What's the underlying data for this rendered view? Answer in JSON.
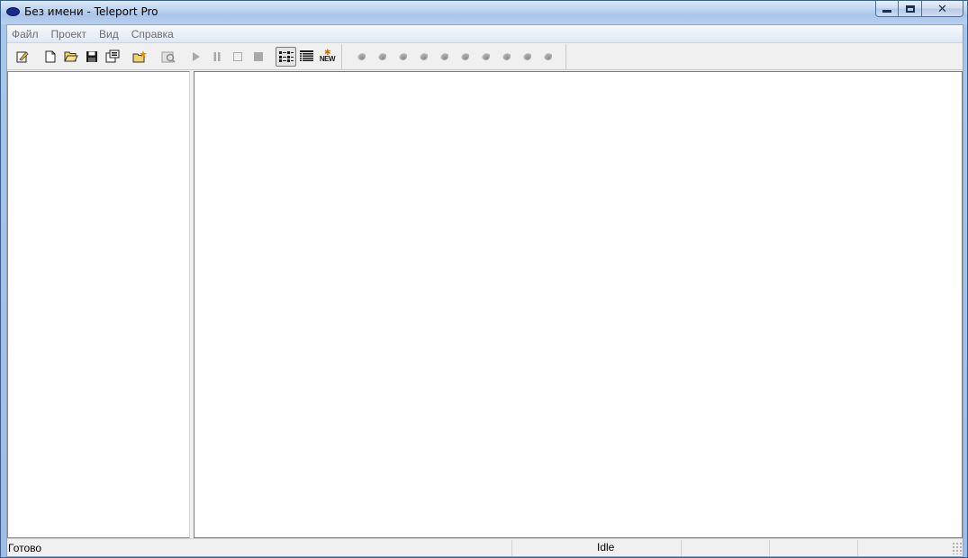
{
  "window": {
    "title": "Без имени - Teleport Pro"
  },
  "menu": {
    "items": [
      "Файл",
      "Проект",
      "Вид",
      "Справка"
    ]
  },
  "toolbar": {
    "buttons": [
      {
        "icon": "project-properties-icon"
      },
      {
        "icon": "new-project-icon"
      },
      {
        "icon": "open-project-icon"
      },
      {
        "icon": "save-project-icon"
      },
      {
        "icon": "project-settings-icon"
      },
      {
        "icon": "new-address-icon"
      },
      {
        "icon": "browse-icon"
      },
      {
        "icon": "start-icon"
      },
      {
        "icon": "pause-icon"
      },
      {
        "icon": "stop-icon"
      },
      {
        "icon": "stop-all-icon"
      },
      {
        "icon": "list-view-icon"
      },
      {
        "icon": "details-view-icon"
      },
      {
        "icon": "new-files-icon",
        "label": "NEW"
      }
    ],
    "level_buttons": 10
  },
  "status": {
    "main": "Готово",
    "state": "Idle"
  },
  "colors": {
    "title_gradient_top": "#dbe8f7",
    "title_gradient_bottom": "#a9c5ea",
    "face": "#f0f0f0",
    "pane": "#ffffff"
  }
}
